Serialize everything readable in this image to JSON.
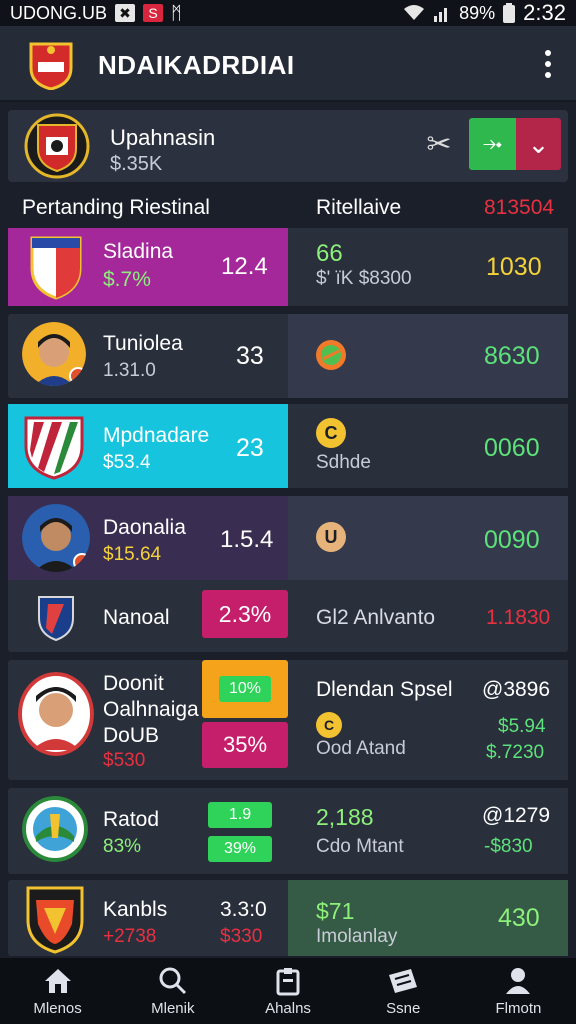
{
  "status_bar": {
    "carrier": "UDONG.UB",
    "icon_box_1": "✖",
    "icon_box_2": "S",
    "icon_extra": "ᛗ",
    "battery_pct": "89%",
    "time": "2:32"
  },
  "app_bar": {
    "title": "NDAIKADRDIAI"
  },
  "profile": {
    "name": "Upahnasin",
    "amount": "$.35K",
    "split_left_icon": "⤞",
    "split_right_icon": "⌄"
  },
  "columns": {
    "left": "Pertanding Riestinal",
    "mid": "Ritellaive",
    "right": "813504"
  },
  "rows": [
    {
      "name": "Sladina",
      "sub": "$.7%",
      "value": "12.4",
      "mid_top": "66",
      "mid_bottom": "$' ïK $8300",
      "right": "1030"
    },
    {
      "name": "Tuniolea",
      "sub": "1.31.0",
      "value": "33",
      "right": "8630"
    },
    {
      "name": "Mpdnadare",
      "sub": "$53.4",
      "value": "23",
      "coin": "C",
      "mid_bottom": "Sdhde",
      "right": "0060"
    },
    {
      "name": "Daonalia",
      "sub": "$15.64",
      "value": "1.5.4",
      "coin": "U",
      "right": "0090"
    },
    {
      "name": "Nanoal",
      "badge": "2.3%",
      "mid": "Gl2 Anlvanto",
      "right": "1.1830"
    },
    {
      "name_1": "Doonit",
      "name_2": "Oalhnaiga",
      "name_3": "DoUB",
      "sub": "$530",
      "badge_top": "10%",
      "badge_bottom": "35%",
      "mid_top": "Dlendan Spsel",
      "mid_bottom": "Ood Atand",
      "right_top": "@3896",
      "right_mid": "$5.94",
      "right_bottom": "$.7230"
    },
    {
      "name": "Ratod",
      "sub": "83%",
      "badge_top": "1.9",
      "badge_bottom": "39%",
      "mid_top": "2,188",
      "mid_bottom": "Cdo Mtant",
      "right_top": "@1279",
      "right_bottom": "-$830"
    },
    {
      "name": "Kanbls",
      "sub": "+2738",
      "value_top": "3.3:0",
      "value_bottom": "$330",
      "mid_top": "$71",
      "mid_bottom": "Imolanlay",
      "right": "430"
    }
  ],
  "bottom_nav": [
    {
      "label": "Mlenos",
      "icon": "home-icon"
    },
    {
      "label": "Mlenik",
      "icon": "search-icon"
    },
    {
      "label": "Ahalns",
      "icon": "clipboard-icon"
    },
    {
      "label": "Ssne",
      "icon": "ticket-icon"
    },
    {
      "label": "Flmotn",
      "icon": "profile-icon"
    }
  ],
  "colors": {
    "background": "#1b1f2a",
    "purple": "#a4289a",
    "cyan": "#17c4dd",
    "magenta": "#c51f6c",
    "orange": "#f5a31a",
    "green": "#2fd35a",
    "yellow": "#f4d23a",
    "red": "#e83040"
  }
}
